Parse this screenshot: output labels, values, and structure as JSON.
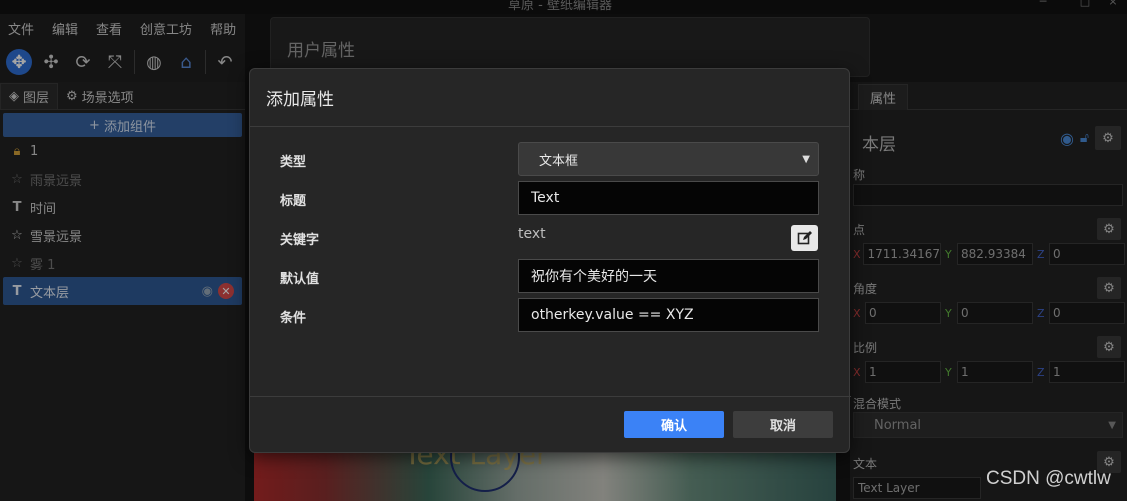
{
  "window": {
    "title": "草原 - 壁纸编辑器"
  },
  "menu": [
    "文件",
    "编辑",
    "查看",
    "创意工坊",
    "帮助"
  ],
  "left_panel": {
    "tabs": [
      {
        "label": "图层",
        "icon": "layers-icon"
      },
      {
        "label": "场景选项",
        "icon": "gear-icon"
      }
    ],
    "add_button": "添加组件",
    "layers": [
      {
        "label": "1",
        "icon": "lock-icon",
        "dim": false,
        "selected": false
      },
      {
        "label": "雨景远景",
        "icon": "star-icon",
        "dim": true,
        "selected": false
      },
      {
        "label": "时间",
        "icon": "text-icon",
        "dim": false,
        "selected": false
      },
      {
        "label": "雪景远景",
        "icon": "star-icon",
        "dim": false,
        "selected": false
      },
      {
        "label": "雾 1",
        "icon": "star-icon",
        "dim": true,
        "selected": false
      },
      {
        "label": "文本层",
        "icon": "text-icon",
        "dim": false,
        "selected": true
      }
    ]
  },
  "background_dialog": {
    "title": "用户属性"
  },
  "canvas": {
    "preview_text": "Text Layer"
  },
  "right_panel": {
    "tab": "属性",
    "layer_title": "本层",
    "name_label": "称",
    "origin_label": "点",
    "origin": {
      "x": "1711.34167",
      "y": "882.93384",
      "z": "0"
    },
    "angle_label": "角度",
    "angle": {
      "x": "0",
      "y": "0",
      "z": "0"
    },
    "scale_label": "比例",
    "scale": {
      "x": "1",
      "y": "1",
      "z": "1"
    },
    "blend_label": "混合模式",
    "blend_value": "Normal",
    "text_label": "文本",
    "text_value": "Text Layer"
  },
  "modal": {
    "title": "添加属性",
    "fields": {
      "type_label": "类型",
      "type_value": "文本框",
      "title_label": "标题",
      "title_value": "Text",
      "key_label": "关键字",
      "key_value": "text",
      "default_label": "默认值",
      "default_value": "祝你有个美好的一天",
      "condition_label": "条件",
      "condition_value": "otherkey.value == XYZ"
    },
    "confirm": "确认",
    "cancel": "取消"
  },
  "watermark": "CSDN @cwtlw",
  "colors": {
    "accent": "#3b82f6",
    "selection": "#2f5a96",
    "danger": "#d84a4a"
  }
}
